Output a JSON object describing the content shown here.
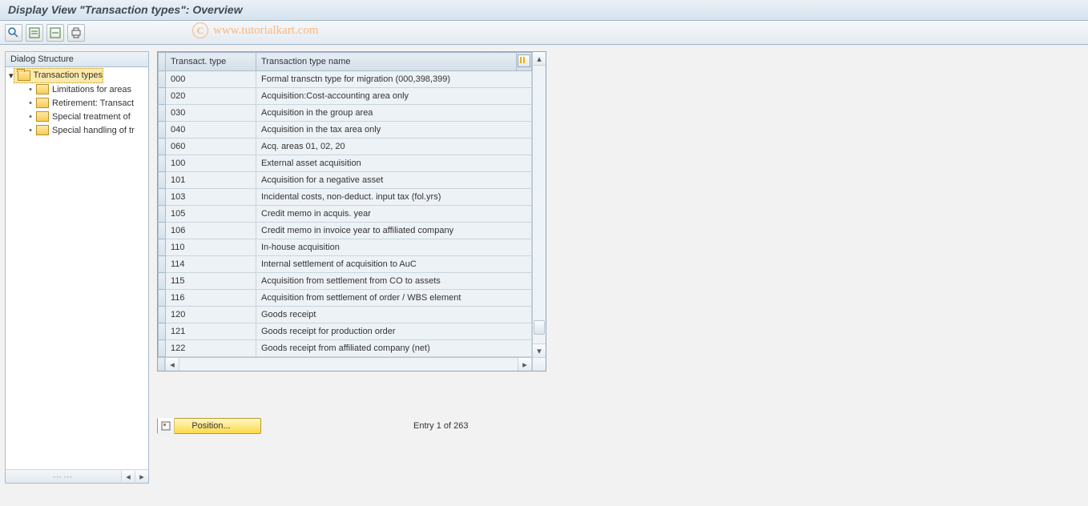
{
  "title": "Display View \"Transaction types\": Overview",
  "watermark": "www.tutorialkart.com",
  "sidebar": {
    "header": "Dialog Structure",
    "root": {
      "label": "Transaction types"
    },
    "children": [
      {
        "label": "Limitations for areas"
      },
      {
        "label": "Retirement: Transact"
      },
      {
        "label": "Special treatment of"
      },
      {
        "label": "Special handling of tr"
      }
    ]
  },
  "table": {
    "columns": {
      "code": "Transact. type",
      "name": "Transaction type name"
    },
    "rows": [
      {
        "code": "000",
        "name": "Formal transctn type for migration (000,398,399)"
      },
      {
        "code": "020",
        "name": "Acquisition:Cost-accounting area only"
      },
      {
        "code": "030",
        "name": "Acquisition in the group area"
      },
      {
        "code": "040",
        "name": "Acquisition in the tax area only"
      },
      {
        "code": "060",
        "name": "Acq. areas 01, 02, 20"
      },
      {
        "code": "100",
        "name": "External asset acquisition"
      },
      {
        "code": "101",
        "name": "Acquisition for a negative asset"
      },
      {
        "code": "103",
        "name": "Incidental costs, non-deduct. input tax (fol.yrs)"
      },
      {
        "code": "105",
        "name": "Credit memo in acquis. year"
      },
      {
        "code": "106",
        "name": "Credit memo in invoice year to affiliated company"
      },
      {
        "code": "110",
        "name": "In-house acquisition"
      },
      {
        "code": "114",
        "name": "Internal settlement of acquisition to AuC"
      },
      {
        "code": "115",
        "name": "Acquisition from settlement from CO to assets"
      },
      {
        "code": "116",
        "name": "Acquisition from settlement of order / WBS element"
      },
      {
        "code": "120",
        "name": "Goods receipt"
      },
      {
        "code": "121",
        "name": "Goods receipt for production order"
      },
      {
        "code": "122",
        "name": "Goods receipt from affiliated company (net)"
      }
    ]
  },
  "footer": {
    "position_label": "Position...",
    "entry_info": "Entry 1 of 263"
  }
}
